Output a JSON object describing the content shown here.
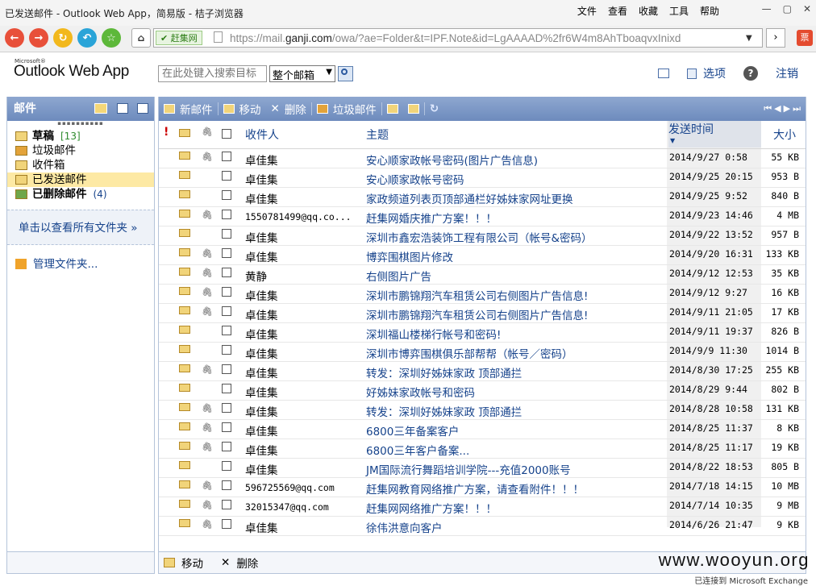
{
  "window": {
    "title": "已发送邮件 - Outlook Web App，简易版 - 桔子浏览器",
    "menus": [
      "文件",
      "查看",
      "收藏",
      "工具",
      "帮助"
    ]
  },
  "toolbar": {
    "security_label": "赶集网",
    "url_prefix": "https://mail.",
    "url_domain": "ganji.com",
    "url_rest": "/owa/?ae=Folder&t=IPF.Note&id=LgAAAAD%2fr6W4m8AhTboaqvxInixd",
    "ticket_label": "票"
  },
  "header": {
    "logo_small": "Microsoft®",
    "logo": "Outlook Web App",
    "search_placeholder": "在此处键入搜索目标",
    "search_scope": "整个邮箱",
    "options_label": "选项",
    "help_label": "?",
    "logout_label": "注销"
  },
  "sidebar": {
    "title": "邮件",
    "folders": [
      {
        "label": "草稿",
        "count": "[13]",
        "bold": true,
        "color": "#f1d47a"
      },
      {
        "label": "垃圾邮件",
        "count": "",
        "bold": false,
        "color": "#e3a33a"
      },
      {
        "label": "收件箱",
        "count": "",
        "bold": false,
        "color": "#f1d47a"
      },
      {
        "label": "已发送邮件",
        "count": "",
        "bold": false,
        "color": "#f1d47a",
        "selected": true
      },
      {
        "label": "已删除邮件",
        "count": "(4)",
        "bold": true,
        "color": "#6fa64a"
      }
    ],
    "view_all": "单击以查看所有文件夹 »",
    "manage": "管理文件夹..."
  },
  "main_toolbar": {
    "new_label": "新邮件",
    "move_label": "移动",
    "delete_label": "删除",
    "junk_label": "垃圾邮件"
  },
  "columns": {
    "to": "收件人",
    "subject": "主题",
    "sent": "发送时间",
    "size": "大小"
  },
  "messages": [
    {
      "to": "卓佳集",
      "subject": "安心顺家政帐号密码(图片广告信息)",
      "date": "2014/9/27 0:58",
      "size": "55 KB",
      "attach": true,
      "mono": false
    },
    {
      "to": "卓佳集",
      "subject": "安心顺家政帐号密码",
      "date": "2014/9/25 20:15",
      "size": "953 B",
      "attach": false,
      "mono": false
    },
    {
      "to": "卓佳集",
      "subject": "家政频道列表页顶部通栏好姊妹家网址更换",
      "date": "2014/9/25 9:52",
      "size": "840 B",
      "attach": false,
      "mono": false
    },
    {
      "to": "1550781499@qq.co...",
      "subject": "赶集网婚庆推广方案！！！",
      "date": "2014/9/23 14:46",
      "size": "4 MB",
      "attach": true,
      "mono": true
    },
    {
      "to": "卓佳集",
      "subject": "深圳市鑫宏浩装饰工程有限公司（帐号&密码）",
      "date": "2014/9/22 13:52",
      "size": "957 B",
      "attach": false,
      "mono": false
    },
    {
      "to": "卓佳集",
      "subject": "博弈围棋图片修改",
      "date": "2014/9/20 16:31",
      "size": "133 KB",
      "attach": true,
      "mono": false
    },
    {
      "to": "黄静",
      "subject": "右侧图片广告",
      "date": "2014/9/12 12:53",
      "size": "35 KB",
      "attach": true,
      "mono": false
    },
    {
      "to": "卓佳集",
      "subject": "深圳市鹏锦翔汽车租赁公司右侧图片广告信息!",
      "date": "2014/9/12 9:27",
      "size": "16 KB",
      "attach": true,
      "mono": false
    },
    {
      "to": "卓佳集",
      "subject": "深圳市鹏锦翔汽车租赁公司右侧图片广告信息!",
      "date": "2014/9/11 21:05",
      "size": "17 KB",
      "attach": true,
      "mono": false
    },
    {
      "to": "卓佳集",
      "subject": "深圳福山楼梯行帐号和密码!",
      "date": "2014/9/11 19:37",
      "size": "826 B",
      "attach": false,
      "mono": false
    },
    {
      "to": "卓佳集",
      "subject": "深圳市博弈围棋俱乐部帮帮（帐号／密码）",
      "date": "2014/9/9 11:30",
      "size": "1014 B",
      "attach": false,
      "mono": false
    },
    {
      "to": "卓佳集",
      "subject": "转发：深圳好姊妹家政 顶部通拦",
      "date": "2014/8/30 17:25",
      "size": "255 KB",
      "attach": true,
      "mono": false
    },
    {
      "to": "卓佳集",
      "subject": "好姊妹家政帐号和密码",
      "date": "2014/8/29 9:44",
      "size": "802 B",
      "attach": false,
      "mono": false
    },
    {
      "to": "卓佳集",
      "subject": "转发：深圳好姊妹家政 顶部通拦",
      "date": "2014/8/28 10:58",
      "size": "131 KB",
      "attach": true,
      "mono": false
    },
    {
      "to": "卓佳集",
      "subject": "6800三年备案客户",
      "date": "2014/8/25 11:37",
      "size": "8 KB",
      "attach": true,
      "mono": false
    },
    {
      "to": "卓佳集",
      "subject": "6800三年客户备案...",
      "date": "2014/8/25 11:17",
      "size": "19 KB",
      "attach": true,
      "mono": false
    },
    {
      "to": "卓佳集",
      "subject": "JM国际流行舞蹈培训学院---充值2000账号",
      "date": "2014/8/22 18:53",
      "size": "805 B",
      "attach": false,
      "mono": false
    },
    {
      "to": "596725569@qq.com",
      "subject": "赶集网教育网络推广方案，请查看附件！！！",
      "date": "2014/7/18 14:15",
      "size": "10 MB",
      "attach": true,
      "mono": true
    },
    {
      "to": "32015347@qq.com",
      "subject": "赶集网网络推广方案！！！",
      "date": "2014/7/14 10:35",
      "size": "9 MB",
      "attach": true,
      "mono": true
    },
    {
      "to": "卓佳集",
      "subject": "徐伟洪意向客户",
      "date": "2014/6/26 21:47",
      "size": "9 KB",
      "attach": true,
      "mono": false
    }
  ],
  "footer": {
    "move_label": "移动",
    "delete_label": "删除",
    "watermark": "www.wooyun.org",
    "status": "已连接到 Microsoft Exchange"
  }
}
